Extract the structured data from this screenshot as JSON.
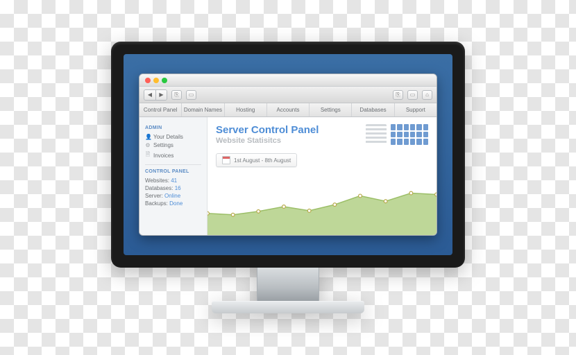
{
  "window": {
    "traffic_lights": [
      "close",
      "minimize",
      "zoom"
    ]
  },
  "tabs": [
    {
      "label": "Control Panel"
    },
    {
      "label": "Domain Names"
    },
    {
      "label": "Hosting"
    },
    {
      "label": "Accounts"
    },
    {
      "label": "Settings"
    },
    {
      "label": "Databases"
    },
    {
      "label": "Support"
    }
  ],
  "sidebar": {
    "admin_header": "ADMIN",
    "admin_items": [
      {
        "icon": "user-icon",
        "label": "Your Details"
      },
      {
        "icon": "gear-icon",
        "label": "Settings"
      },
      {
        "icon": "document-icon",
        "label": "Invoices"
      }
    ],
    "cp_header": "CONTROL PANEL",
    "stats": {
      "websites_label": "Websites:",
      "websites_value": "41",
      "db_label": "Databases:",
      "db_value": "16",
      "server_label": "Server:",
      "server_value": "Online",
      "backups_label": "Backups:",
      "backups_value": "Done"
    }
  },
  "main": {
    "title": "Server Control Panel",
    "subtitle": "Website Statisitcs",
    "date_range": "1st August - 8th August"
  },
  "chart_data": {
    "type": "area",
    "title": "Website Statisitcs",
    "x": [
      0,
      1,
      2,
      3,
      4,
      5,
      6,
      7,
      8,
      9
    ],
    "values": [
      32,
      30,
      35,
      42,
      36,
      45,
      58,
      50,
      62,
      60
    ],
    "ylim": [
      0,
      80
    ],
    "show_points": true,
    "fill_color": "#b7d38d",
    "line_color": "#9cbf68"
  }
}
